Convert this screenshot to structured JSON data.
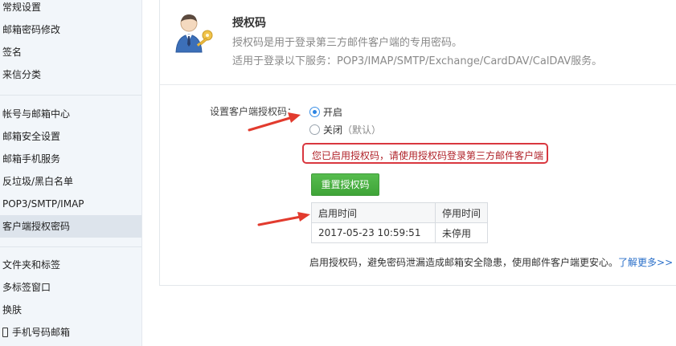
{
  "sidebar": {
    "items": [
      {
        "label": "常规设置"
      },
      {
        "label": "邮箱密码修改"
      },
      {
        "label": "签名"
      },
      {
        "label": "来信分类"
      },
      {
        "label": "帐号与邮箱中心"
      },
      {
        "label": "邮箱安全设置"
      },
      {
        "label": "邮箱手机服务"
      },
      {
        "label": "反垃圾/黑白名单"
      },
      {
        "label": "POP3/SMTP/IMAP"
      },
      {
        "label": "客户端授权密码",
        "active": true
      },
      {
        "label": "文件夹和标签"
      },
      {
        "label": "多标签窗口"
      },
      {
        "label": "换肤"
      },
      {
        "label": "手机号码邮箱",
        "icon": "phone-icon"
      }
    ]
  },
  "header": {
    "icon": "user-key-icon",
    "title": "授权码",
    "desc1": "授权码是用于登录第三方邮件客户端的专用密码。",
    "desc2": "适用于登录以下服务：POP3/IMAP/SMTP/Exchange/CardDAV/CalDAV服务。"
  },
  "settings": {
    "label": "设置客户端授权码：",
    "options": [
      {
        "label": "开启",
        "sub": "",
        "checked": true
      },
      {
        "label": "关闭",
        "sub": "（默认）",
        "checked": false
      }
    ],
    "notice": "您已启用授权码，请使用授权码登录第三方邮件客户端",
    "reset_button": "重置授权码"
  },
  "table": {
    "headers": [
      "启用时间",
      "停用时间"
    ],
    "rows": [
      [
        "2017-05-23 10:59:51",
        "未停用"
      ]
    ]
  },
  "footer": {
    "text": "启用授权码，避免密码泄漏造成邮箱安全隐患，使用邮件客户端更安心。",
    "link": "了解更多>>"
  },
  "colors": {
    "accent_green": "#48ad41",
    "notice_red": "#d9373f",
    "arrow_red": "#e23b2e",
    "link_blue": "#2a6fc9",
    "sidebar_bg": "#f2f6fa"
  }
}
